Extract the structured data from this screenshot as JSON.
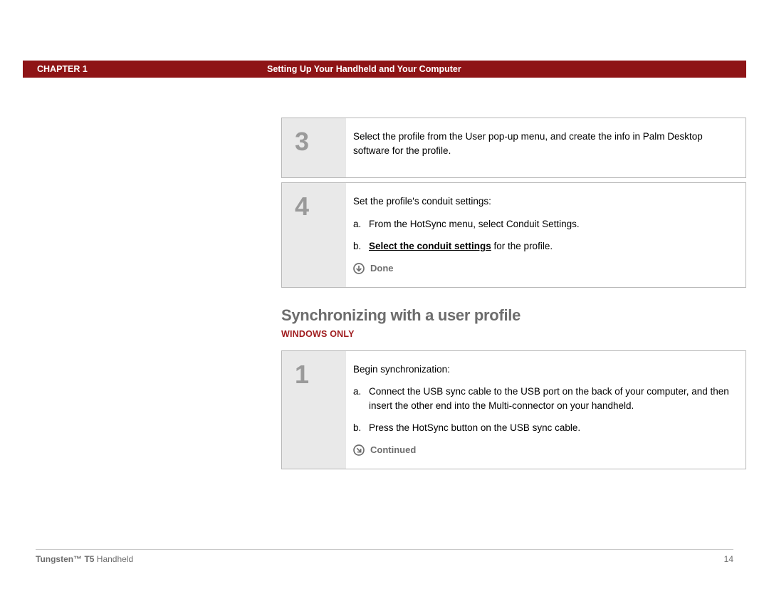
{
  "header": {
    "chapter": "CHAPTER 1",
    "title": "Setting Up Your Handheld and Your Computer"
  },
  "steps_a": [
    {
      "num": "3",
      "lead": "Select the profile from the User pop-up menu, and create the info in Palm Desktop software for the profile."
    },
    {
      "num": "4",
      "lead": "Set the profile's conduit settings:",
      "subs": [
        {
          "letter": "a.",
          "text": "From the HotSync menu, select Conduit Settings."
        },
        {
          "letter": "b.",
          "link": "Select the conduit settings",
          "after": " for the profile."
        }
      ],
      "done": "Done"
    }
  ],
  "section": {
    "heading": "Synchronizing with a user profile",
    "tag": "WINDOWS ONLY"
  },
  "steps_b": [
    {
      "num": "1",
      "lead": "Begin synchronization:",
      "subs": [
        {
          "letter": "a.",
          "text": "Connect the USB sync cable to the USB port on the back of your computer, and then insert the other end into the Multi-connector on your handheld."
        },
        {
          "letter": "b.",
          "text": "Press the HotSync button on the USB sync cable."
        }
      ],
      "continued": "Continued"
    }
  ],
  "footer": {
    "product_bold": "Tungsten™ T5",
    "product_rest": " Handheld",
    "page": "14"
  }
}
